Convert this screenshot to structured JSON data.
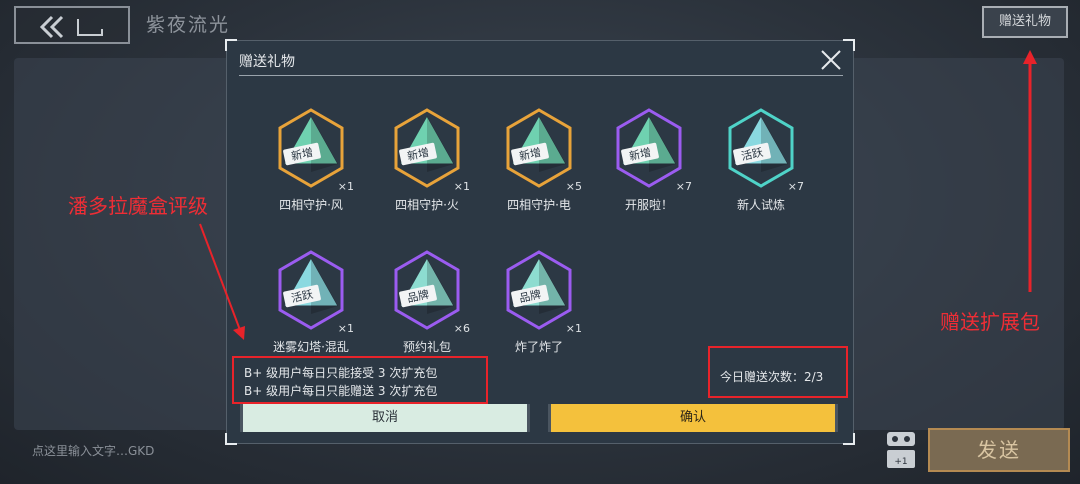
{
  "chat": {
    "title": "紫夜流光",
    "gift_button": "赠送礼物",
    "input_placeholder": "点这里输入文字…GKD",
    "send_button": "发送"
  },
  "modal": {
    "title": "赠送礼物",
    "items": [
      {
        "label": "四相守护·风",
        "count": "×1",
        "badge": "新增",
        "frame": "gold"
      },
      {
        "label": "四相守护·火",
        "count": "×1",
        "badge": "新增",
        "frame": "gold"
      },
      {
        "label": "四相守护·电",
        "count": "×5",
        "badge": "新增",
        "frame": "gold"
      },
      {
        "label": "开服啦！",
        "count": "×7",
        "badge": "新增",
        "frame": "purple"
      },
      {
        "label": "新人试炼",
        "count": "×7",
        "badge": "活跃",
        "frame": "teal"
      },
      {
        "label": "迷雾幻塔·混乱",
        "count": "×1",
        "badge": "活跃",
        "frame": "purple"
      },
      {
        "label": "预约礼包",
        "count": "×6",
        "badge": "品牌",
        "frame": "purple"
      },
      {
        "label": "炸了炸了",
        "count": "×1",
        "badge": "品牌",
        "frame": "purple"
      }
    ],
    "rule_receive": "B+ 级用户每日只能接受 3 次扩充包",
    "rule_send": "B+ 级用户每日只能赠送 3 次扩充包",
    "counter": "今日赠送次数：2/3",
    "cancel_button": "取消",
    "confirm_button": "确认"
  },
  "annotations": {
    "rating_label": "潘多拉魔盒评级",
    "pack_label": "赠送扩展包",
    "color": "#e8232a"
  }
}
